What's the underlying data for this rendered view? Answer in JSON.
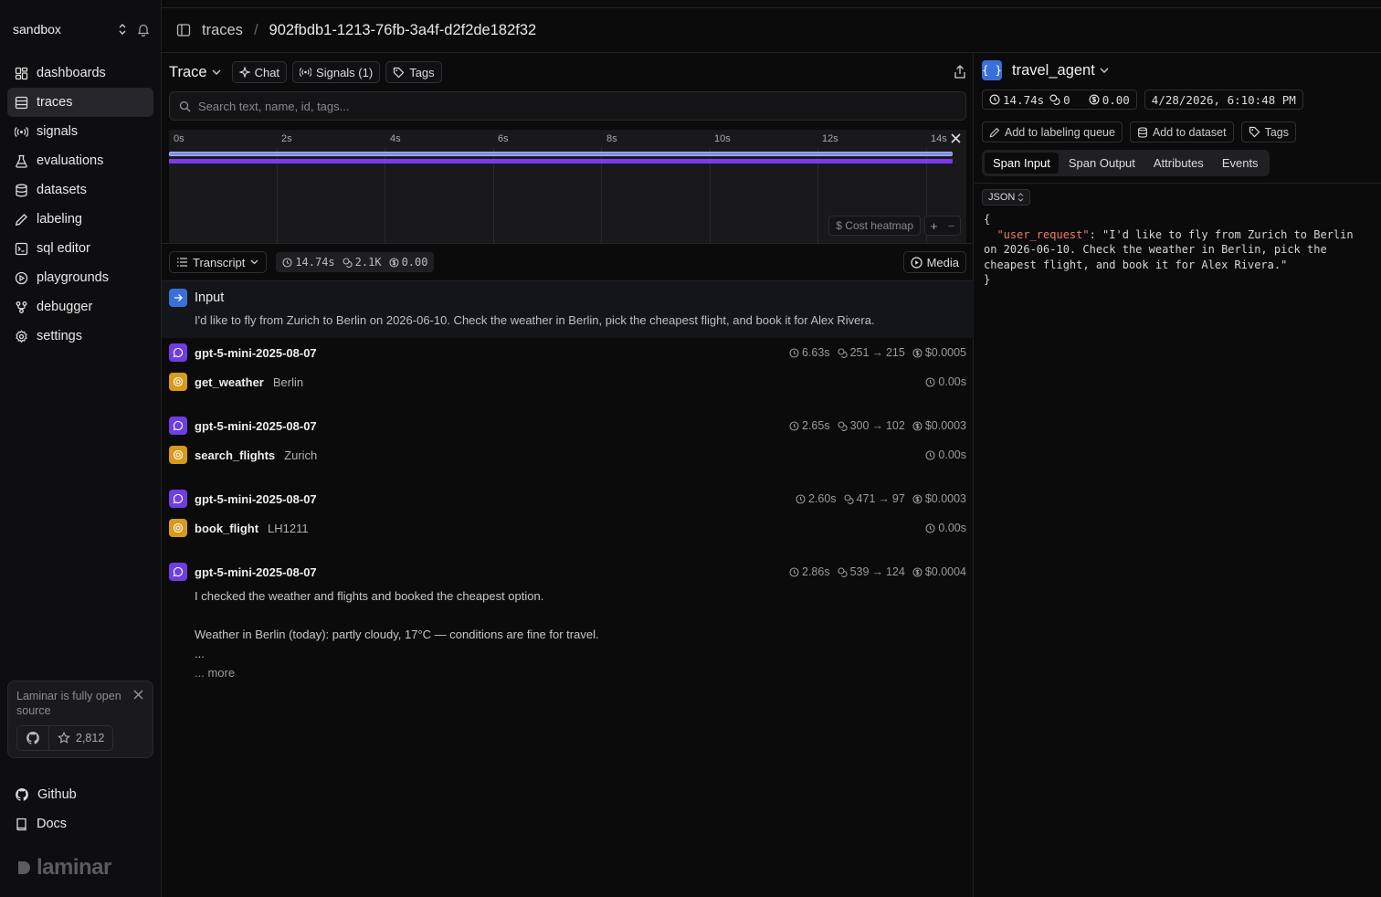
{
  "sidebar": {
    "workspace": "sandbox",
    "items": [
      {
        "label": "dashboards",
        "icon": "dashboard-icon"
      },
      {
        "label": "traces",
        "icon": "list-icon"
      },
      {
        "label": "signals",
        "icon": "signal-icon"
      },
      {
        "label": "evaluations",
        "icon": "flask-icon"
      },
      {
        "label": "datasets",
        "icon": "database-icon"
      },
      {
        "label": "labeling",
        "icon": "pen-icon"
      },
      {
        "label": "sql editor",
        "icon": "terminal-icon"
      },
      {
        "label": "playgrounds",
        "icon": "play-icon"
      },
      {
        "label": "debugger",
        "icon": "debug-icon"
      },
      {
        "label": "settings",
        "icon": "gear-icon"
      }
    ],
    "active": "traces",
    "promo": {
      "text": "Laminar is fully open source",
      "stars": "2,812"
    },
    "footer": [
      {
        "label": "Github",
        "icon": "github-icon"
      },
      {
        "label": "Docs",
        "icon": "book-icon"
      }
    ],
    "brand": "laminar"
  },
  "breadcrumb": {
    "section": "traces",
    "separator": "/",
    "trace_id": "902fbdb1-1213-76fb-3a4f-d2f2de182f32"
  },
  "toolbar": {
    "title": "Trace",
    "chat": "Chat",
    "signals": "Signals (1)",
    "tags": "Tags"
  },
  "search": {
    "placeholder": "Search text, name, id, tags..."
  },
  "timeline": {
    "ticks": [
      "0s",
      "2s",
      "4s",
      "6s",
      "8s",
      "10s",
      "12s",
      "14s"
    ],
    "cost_heatmap": "$ Cost heatmap"
  },
  "transcript": {
    "view": "Transcript",
    "duration": "14.74s",
    "tokens": "2.1K",
    "cost": "0.00",
    "media": "Media"
  },
  "input": {
    "label": "Input",
    "text": "I'd like to fly from Zurich to Berlin on 2026-06-10. Check the weather in Berlin, pick the cheapest flight, and book it for Alex Rivera."
  },
  "spans": [
    {
      "type": "llm",
      "name": "gpt-5-mini-2025-08-07",
      "duration": "6.63s",
      "tokens_in": "251",
      "tokens_out": "215",
      "cost": "$0.0005"
    },
    {
      "type": "tool",
      "name": "get_weather",
      "arg": "Berlin",
      "duration": "0.00s"
    },
    {
      "type": "llm",
      "name": "gpt-5-mini-2025-08-07",
      "duration": "2.65s",
      "tokens_in": "300",
      "tokens_out": "102",
      "cost": "$0.0003"
    },
    {
      "type": "tool",
      "name": "search_flights",
      "arg": "Zurich",
      "duration": "0.00s"
    },
    {
      "type": "llm",
      "name": "gpt-5-mini-2025-08-07",
      "duration": "2.60s",
      "tokens_in": "471",
      "tokens_out": "97",
      "cost": "$0.0003"
    },
    {
      "type": "tool",
      "name": "book_flight",
      "arg": "LH1211",
      "duration": "0.00s"
    },
    {
      "type": "llm",
      "name": "gpt-5-mini-2025-08-07",
      "duration": "2.86s",
      "tokens_in": "539",
      "tokens_out": "124",
      "cost": "$0.0004"
    }
  ],
  "final_output": {
    "line1": "I checked the weather and flights and booked the cheapest option.",
    "line2": "Weather in Berlin (today): partly cloudy, 17°C — conditions are fine for travel.",
    "line3": "...",
    "more": "... more"
  },
  "detail": {
    "span_name": "travel_agent",
    "duration": "14.74s",
    "tokens": "0",
    "cost": "0.00",
    "timestamp": "4/28/2026, 6:10:48 PM",
    "actions": [
      "Add to labeling queue",
      "Add to dataset",
      "Tags"
    ],
    "tabs": [
      "Span Input",
      "Span Output",
      "Attributes",
      "Events"
    ],
    "active_tab": "Span Input",
    "format": "JSON",
    "json_open": "{",
    "json_key": "\"user_request\"",
    "json_value": ": \"I'd like to fly from Zurich to Berlin on 2026-06-10. Check the weather in Berlin, pick the cheapest flight, and book it for Alex Rivera.\"",
    "json_close": "}"
  }
}
